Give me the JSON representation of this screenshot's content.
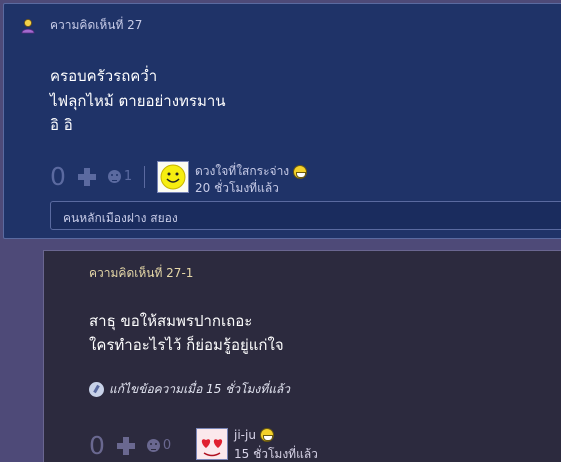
{
  "comment": {
    "header_label": "ความคิดเห็นที่ 27",
    "body_lines": [
      "ครอบครัวรถคว่ำ",
      "ไฟลุกไหม้ ตายอย่างทรมาน",
      "อิ อิ"
    ],
    "votes": "0",
    "emotion_count": "1",
    "author": "ดวงใจที่ใสกระจ่าง",
    "time": "20 ชั่วโมงที่แล้ว",
    "tag": "คนหลักเมืองฝาง สยอง",
    "icons": {
      "user": "user-icon",
      "plus": "plus-icon",
      "emotion": "emotion-icon",
      "avatar": "smiley-avatar",
      "badge": "smile-icon"
    },
    "colors": {
      "background": "#1f3368",
      "muted": "#5b6aa0",
      "text": "#ffffff"
    }
  },
  "reply": {
    "header_label": "ความคิดเห็นที่ 27-1",
    "body_lines": [
      "สาธุ ขอให้สมพรปากเถอะ",
      "ใครทำอะไรไว้ ก็ย่อมรู้อยู่แก่ใจ"
    ],
    "edit_note": "แก้ไขข้อความเมื่อ 15 ชั่วโมงที่แล้ว",
    "votes": "0",
    "emotion_count": "0",
    "author": "ji-ju",
    "time": "15 ชั่วโมงที่แล้ว",
    "icons": {
      "edit": "edit-icon",
      "plus": "plus-icon",
      "emotion": "emotion-icon",
      "avatar": "hearts-avatar",
      "badge": "smile-icon"
    },
    "colors": {
      "background": "#2c2a3e",
      "header": "#e6d8a8"
    }
  }
}
